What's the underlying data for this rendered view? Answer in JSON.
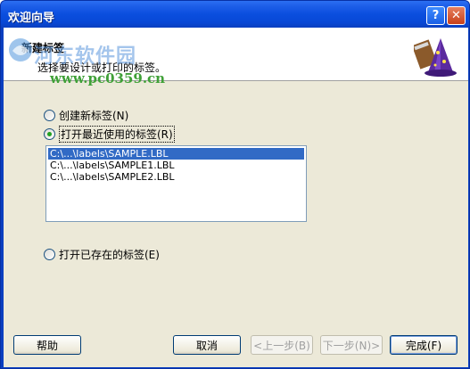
{
  "window": {
    "title": "欢迎向导",
    "help_glyph": "?",
    "close_glyph": "✕"
  },
  "header": {
    "title": "新建标签",
    "subtitle": "选择要设计或打印的标签。",
    "icon": "wizard-hat-icon"
  },
  "watermark": {
    "name": "河东软件园",
    "url": "www.pc0359.cn"
  },
  "options": {
    "new_label": "创建新标签(N)",
    "recent_label": "打开最近使用的标签(R)",
    "existing_label": "打开已存在的标签(E)",
    "selected": "recent"
  },
  "recent_files": [
    "C:\\...\\labels\\SAMPLE.LBL",
    "C:\\...\\labels\\SAMPLE1.LBL",
    "C:\\...\\labels\\SAMPLE2.LBL"
  ],
  "buttons": {
    "help": "帮助",
    "cancel": "取消",
    "back": "<上一步(B)",
    "next": "下一步(N)>",
    "finish": "完成(F)"
  },
  "colors": {
    "titlebar": "#0a4ede",
    "selection": "#316ac5",
    "dialog_bg": "#ece9d8"
  }
}
